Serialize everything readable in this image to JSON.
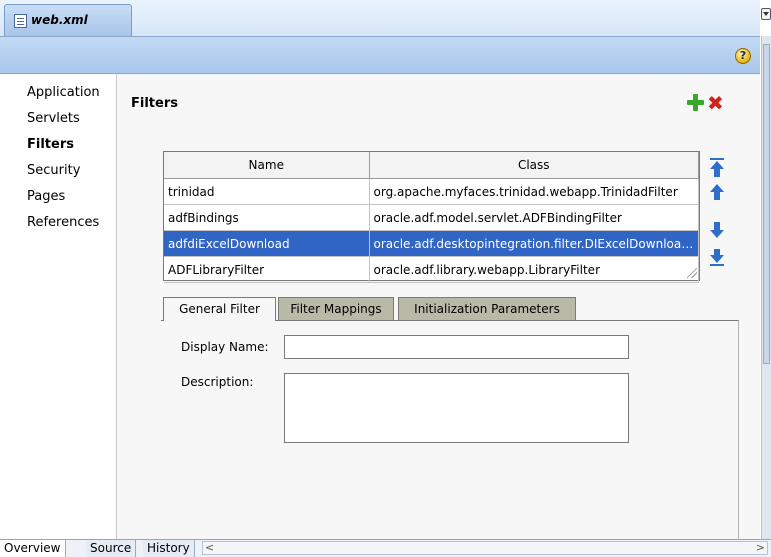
{
  "editor": {
    "file_tab": "web.xml"
  },
  "nav": {
    "items": [
      {
        "label": "Application"
      },
      {
        "label": "Servlets"
      },
      {
        "label": "Filters"
      },
      {
        "label": "Security"
      },
      {
        "label": "Pages"
      },
      {
        "label": "References"
      }
    ],
    "selected": "Filters"
  },
  "section": {
    "title": "Filters"
  },
  "table": {
    "columns": [
      "Name",
      "Class"
    ],
    "rows": [
      {
        "name": "trinidad",
        "class": "org.apache.myfaces.trinidad.webapp.TrinidadFilter"
      },
      {
        "name": "adfBindings",
        "class": "oracle.adf.model.servlet.ADFBindingFilter"
      },
      {
        "name": "adfdiExcelDownload",
        "class": "oracle.adf.desktopintegration.filter.DIExcelDownloadFilter"
      },
      {
        "name": "ADFLibraryFilter",
        "class": "oracle.adf.library.webapp.LibraryFilter"
      }
    ],
    "selected_row": "adfdiExcelDownload"
  },
  "tabs": [
    {
      "label": "General Filter"
    },
    {
      "label": "Filter Mappings"
    },
    {
      "label": "Initialization Parameters"
    }
  ],
  "form": {
    "display_name_label": "Display Name:",
    "display_name_value": "",
    "description_label": "Description:",
    "description_value": ""
  },
  "bottom_tabs": [
    {
      "label": "Overview"
    },
    {
      "label": "Source"
    },
    {
      "label": "History"
    }
  ],
  "icons": {
    "help": "help-icon",
    "add": "add-icon",
    "delete": "delete-icon",
    "move_top": "move-top-icon",
    "move_up": "move-up-icon",
    "move_down": "move-down-icon",
    "move_bottom": "move-bottom-icon"
  },
  "colors": {
    "selection": "#3165c5",
    "add": "#3aa62b",
    "delete": "#d0241c",
    "arrows": "#2e6fc9"
  }
}
